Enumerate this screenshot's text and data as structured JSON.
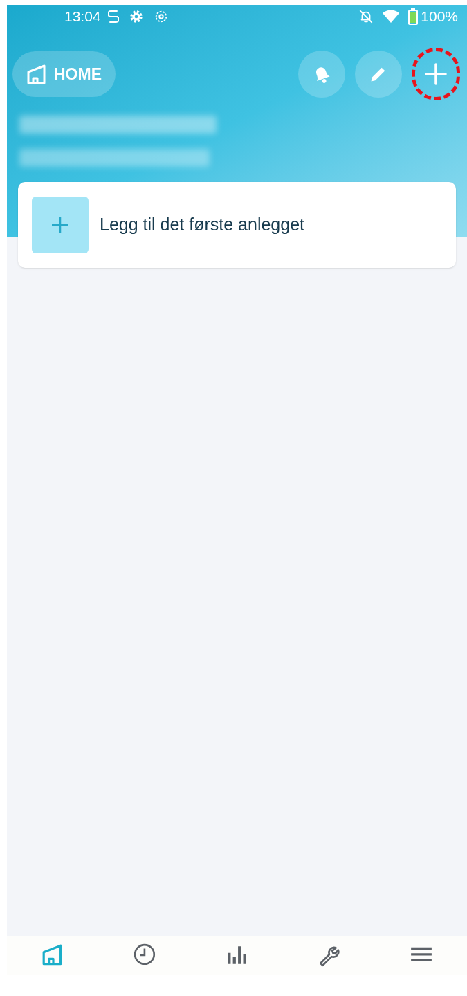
{
  "status_bar": {
    "time": "13:04",
    "battery": "100%"
  },
  "header": {
    "home_button": "HOME",
    "actions": [
      {
        "kind": "bell",
        "highlighted": false
      },
      {
        "kind": "pencil",
        "highlighted": false
      },
      {
        "kind": "plus",
        "highlighted": true
      }
    ]
  },
  "add_card": {
    "label": "Legg til det første anlegget"
  },
  "bottom_nav": [
    {
      "kind": "home",
      "selected": true
    },
    {
      "kind": "clock",
      "selected": false
    },
    {
      "kind": "chart",
      "selected": false
    },
    {
      "kind": "wrench",
      "selected": false
    },
    {
      "kind": "menu",
      "selected": false
    }
  ]
}
